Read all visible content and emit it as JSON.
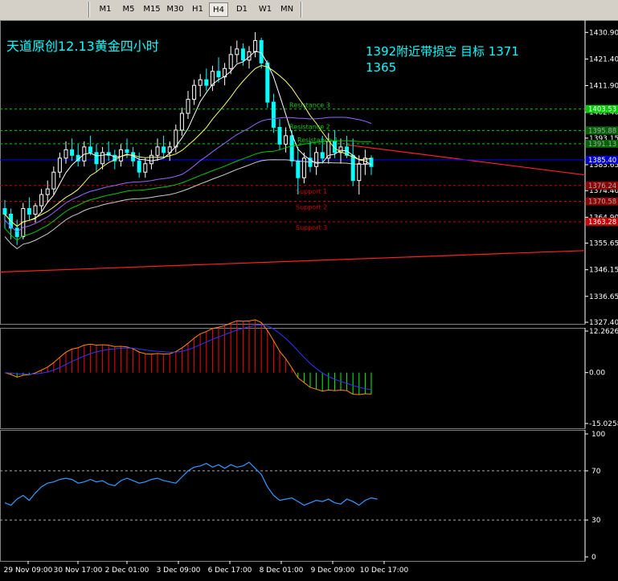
{
  "toolbar": {
    "timeframes": [
      "M1",
      "M5",
      "M15",
      "M30",
      "H1",
      "H4",
      "D1",
      "W1",
      "MN"
    ],
    "active": "H4"
  },
  "chart_data": [
    {
      "type": "candlestick",
      "panel": "price",
      "title": "天道原创12.13黄金四小时",
      "annotation_line1": "1392附近带损空  目标 1371",
      "annotation_line2": "1365",
      "y_ticks": [
        "1430.90",
        "1421.40",
        "1411.90",
        "1402.40",
        "1393.15",
        "1383.65",
        "1374.40",
        "1364.90",
        "1355.65",
        "1346.15",
        "1336.65",
        "1327.40"
      ],
      "ylim": [
        1327.4,
        1433.0
      ],
      "x_ticks": [
        "29 Nov 09:00",
        "30 Nov 17:00",
        "2 Dec 01:00",
        "3 Dec 09:00",
        "6 Dec 17:00",
        "8 Dec 01:00",
        "9 Dec 09:00",
        "10 Dec 17:00"
      ],
      "price_labels": [
        {
          "text": "1403.53",
          "bg": "#00cc00",
          "fg": "#ffffff",
          "value": 1403.53
        },
        {
          "text": "1395.88",
          "bg": "#006400",
          "fg": "#aaaaaa",
          "value": 1395.88
        },
        {
          "text": "1391.13",
          "bg": "#006400",
          "fg": "#aaaaaa",
          "value": 1391.13
        },
        {
          "text": "1385.40",
          "bg": "#0000cc",
          "fg": "#ffffff",
          "value": 1385.4
        },
        {
          "text": "1376.24",
          "bg": "#8b0000",
          "fg": "#aaaaaa",
          "value": 1376.24
        },
        {
          "text": "1370.58",
          "bg": "#8b0000",
          "fg": "#aaaaaa",
          "value": 1370.58
        },
        {
          "text": "1363.28",
          "bg": "#cc0000",
          "fg": "#ffffff",
          "value": 1363.28
        }
      ],
      "levels": [
        {
          "name": "Resistance 3",
          "value": 1403.53,
          "color": "#00cc00"
        },
        {
          "name": "Resistance 2",
          "value": 1395.88,
          "color": "#00cc00"
        },
        {
          "name": "Resistance 1",
          "value": 1391.13,
          "color": "#00cc00"
        },
        {
          "name": "Support 1",
          "value": 1376.24,
          "color": "#cc0000"
        },
        {
          "name": "Support 2",
          "value": 1370.58,
          "color": "#cc0000"
        },
        {
          "name": "Support 3",
          "value": 1363.28,
          "color": "#cc0000"
        }
      ],
      "current_price": 1385.4,
      "candles": [
        [
          1368,
          1371,
          1361,
          1366
        ],
        [
          1366,
          1368,
          1357,
          1361
        ],
        [
          1361,
          1364,
          1355,
          1358
        ],
        [
          1358,
          1370,
          1357,
          1368
        ],
        [
          1368,
          1372,
          1364,
          1366
        ],
        [
          1366,
          1370,
          1363,
          1369
        ],
        [
          1369,
          1375,
          1367,
          1373
        ],
        [
          1373,
          1378,
          1370,
          1375
        ],
        [
          1375,
          1383,
          1373,
          1381
        ],
        [
          1381,
          1388,
          1379,
          1386
        ],
        [
          1386,
          1392,
          1384,
          1389
        ],
        [
          1389,
          1393,
          1385,
          1387
        ],
        [
          1387,
          1391,
          1383,
          1385
        ],
        [
          1385,
          1392,
          1383,
          1390
        ],
        [
          1390,
          1394,
          1387,
          1388
        ],
        [
          1388,
          1391,
          1381,
          1384
        ],
        [
          1384,
          1390,
          1382,
          1388
        ],
        [
          1388,
          1392,
          1385,
          1387
        ],
        [
          1387,
          1389,
          1382,
          1385
        ],
        [
          1385,
          1391,
          1383,
          1389
        ],
        [
          1389,
          1393,
          1386,
          1388
        ],
        [
          1388,
          1390,
          1383,
          1385
        ],
        [
          1385,
          1388,
          1379,
          1381
        ],
        [
          1381,
          1386,
          1379,
          1384
        ],
        [
          1384,
          1389,
          1382,
          1387
        ],
        [
          1387,
          1393,
          1385,
          1390
        ],
        [
          1390,
          1394,
          1386,
          1388
        ],
        [
          1388,
          1392,
          1385,
          1390
        ],
        [
          1390,
          1398,
          1388,
          1396
        ],
        [
          1396,
          1404,
          1394,
          1402
        ],
        [
          1402,
          1410,
          1400,
          1407
        ],
        [
          1407,
          1414,
          1405,
          1412
        ],
        [
          1412,
          1416,
          1408,
          1414
        ],
        [
          1414,
          1418,
          1410,
          1412
        ],
        [
          1412,
          1419,
          1410,
          1417
        ],
        [
          1417,
          1422,
          1413,
          1415
        ],
        [
          1415,
          1420,
          1412,
          1418
        ],
        [
          1418,
          1426,
          1416,
          1423
        ],
        [
          1423,
          1428,
          1420,
          1425
        ],
        [
          1425,
          1427,
          1419,
          1421
        ],
        [
          1421,
          1426,
          1418,
          1424
        ],
        [
          1424,
          1431,
          1422,
          1428
        ],
        [
          1428,
          1429,
          1418,
          1420
        ],
        [
          1420,
          1421,
          1404,
          1406
        ],
        [
          1406,
          1409,
          1395,
          1397
        ],
        [
          1397,
          1400,
          1389,
          1391
        ],
        [
          1391,
          1397,
          1388,
          1394
        ],
        [
          1394,
          1396,
          1383,
          1385
        ],
        [
          1385,
          1390,
          1373,
          1379
        ],
        [
          1379,
          1388,
          1377,
          1386
        ],
        [
          1386,
          1392,
          1381,
          1383
        ],
        [
          1383,
          1390,
          1380,
          1388
        ],
        [
          1388,
          1394,
          1384,
          1386
        ],
        [
          1386,
          1395,
          1384,
          1392
        ],
        [
          1392,
          1396,
          1386,
          1388
        ],
        [
          1388,
          1393,
          1384,
          1390
        ],
        [
          1390,
          1394,
          1386,
          1387
        ],
        [
          1387,
          1393,
          1376,
          1378
        ],
        [
          1378,
          1387,
          1373,
          1384
        ],
        [
          1384,
          1389,
          1380,
          1386
        ],
        [
          1386,
          1387,
          1380,
          1383
        ]
      ]
    },
    {
      "type": "histogram",
      "panel": "macd",
      "y_ticks": [
        "12.2626",
        "0.00",
        "-15.0258"
      ],
      "ylim": [
        -15.0258,
        12.2626
      ]
    },
    {
      "type": "line",
      "panel": "rsi",
      "y_ticks": [
        "100",
        "70",
        "30",
        "0"
      ],
      "ylim": [
        0,
        100
      ],
      "levels": [
        70,
        30
      ],
      "values": [
        44,
        42,
        47,
        50,
        46,
        52,
        57,
        60,
        61,
        63,
        64,
        63,
        60,
        61,
        63,
        61,
        62,
        59,
        58,
        62,
        64,
        62,
        60,
        61,
        63,
        64,
        62,
        61,
        60,
        65,
        70,
        73,
        74,
        76,
        73,
        75,
        72,
        75,
        73,
        74,
        77,
        72,
        67,
        57,
        50,
        46,
        47,
        48,
        45,
        42,
        44,
        46,
        45,
        47,
        44,
        43,
        47,
        45,
        42,
        46,
        48,
        47
      ]
    }
  ],
  "colors": {
    "background": "#000000",
    "grid": "#ffffff",
    "bull": "#ffffff",
    "bear": "#00ffff",
    "axis_text": "#ffffff",
    "title": "#00ffff",
    "hist_pos": "#ff0000",
    "hist_neg": "#00ff00"
  }
}
